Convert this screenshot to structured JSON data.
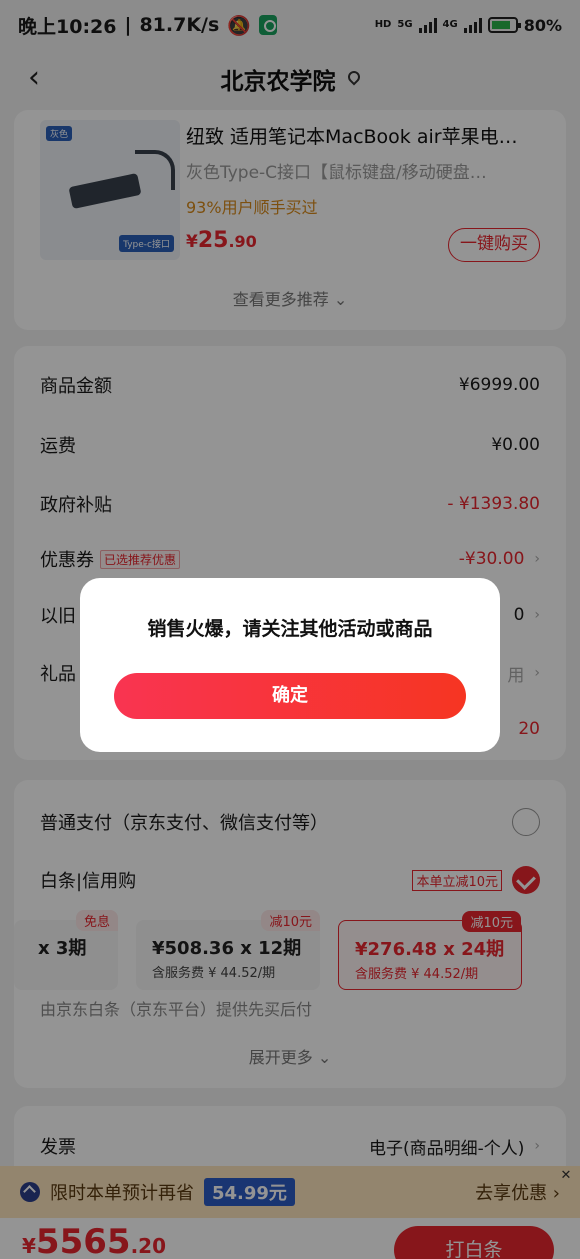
{
  "status_bar": {
    "time": "晚上10:26",
    "speed": "81.7K/s",
    "hd": "HD",
    "net1": "5G",
    "net2": "4G",
    "battery": "80%"
  },
  "header": {
    "title": "北京农学院",
    "back_icon": "chevron-left-icon",
    "location_icon": "location-pin-icon"
  },
  "recommend": {
    "thumb_tag": "灰色",
    "thumb_sub": "Type-c接口",
    "name": "纽致 适用笔记本MacBook air苹果电…",
    "spec": "灰色Type-C接口【鼠标键盘/移动硬盘…",
    "stat": "93%用户顺手买过",
    "price_currency": "¥",
    "price_int": "25",
    "price_dec": ".90",
    "buy_label": "一键购买",
    "more_label": "查看更多推荐 ⌄"
  },
  "fees": {
    "rows": [
      {
        "label": "商品金额",
        "value": "¥6999.00"
      },
      {
        "label": "运费",
        "value": "¥0.00"
      },
      {
        "label": "政府补贴",
        "value": "- ¥1393.80"
      },
      {
        "label": "优惠券",
        "tag": "已选推荐优惠",
        "value": "-¥30.00"
      },
      {
        "label": "以旧",
        "value": "0"
      },
      {
        "label": "礼品",
        "value": "用"
      },
      {
        "label": "",
        "value": "20"
      }
    ],
    "colors": {
      "red": "#e8262f"
    }
  },
  "payment": {
    "normal_label": "普通支付（京东支付、微信支付等）",
    "baitiao_label": "白条|信用购",
    "baitiao_discount": "本单立减10元",
    "plans": [
      {
        "main": "x 3期",
        "sub": "",
        "tag": "免息"
      },
      {
        "main": "¥508.36 x 12期",
        "sub": "含服务费 ¥ 44.52/期",
        "tag": "减10元"
      },
      {
        "main": "¥276.48 x 24期",
        "sub": "含服务费 ¥ 44.52/期",
        "tag": "减10元"
      }
    ],
    "note": "由京东白条（京东平台）提供先买后付",
    "expand_label": "展开更多 ⌄"
  },
  "invoice": {
    "label": "发票",
    "value": "电子(商品明细-个人)"
  },
  "promo": {
    "text": "限时本单预计再省",
    "amount": "54.99元",
    "link": "去享优惠 ›",
    "close": "✕"
  },
  "bottom": {
    "currency": "¥",
    "total_int": "5565",
    "total_dec": ".20",
    "submit_label": "打白条"
  },
  "dialog": {
    "message": "销售火爆，请关注其他活动或商品",
    "confirm_label": "确定"
  }
}
